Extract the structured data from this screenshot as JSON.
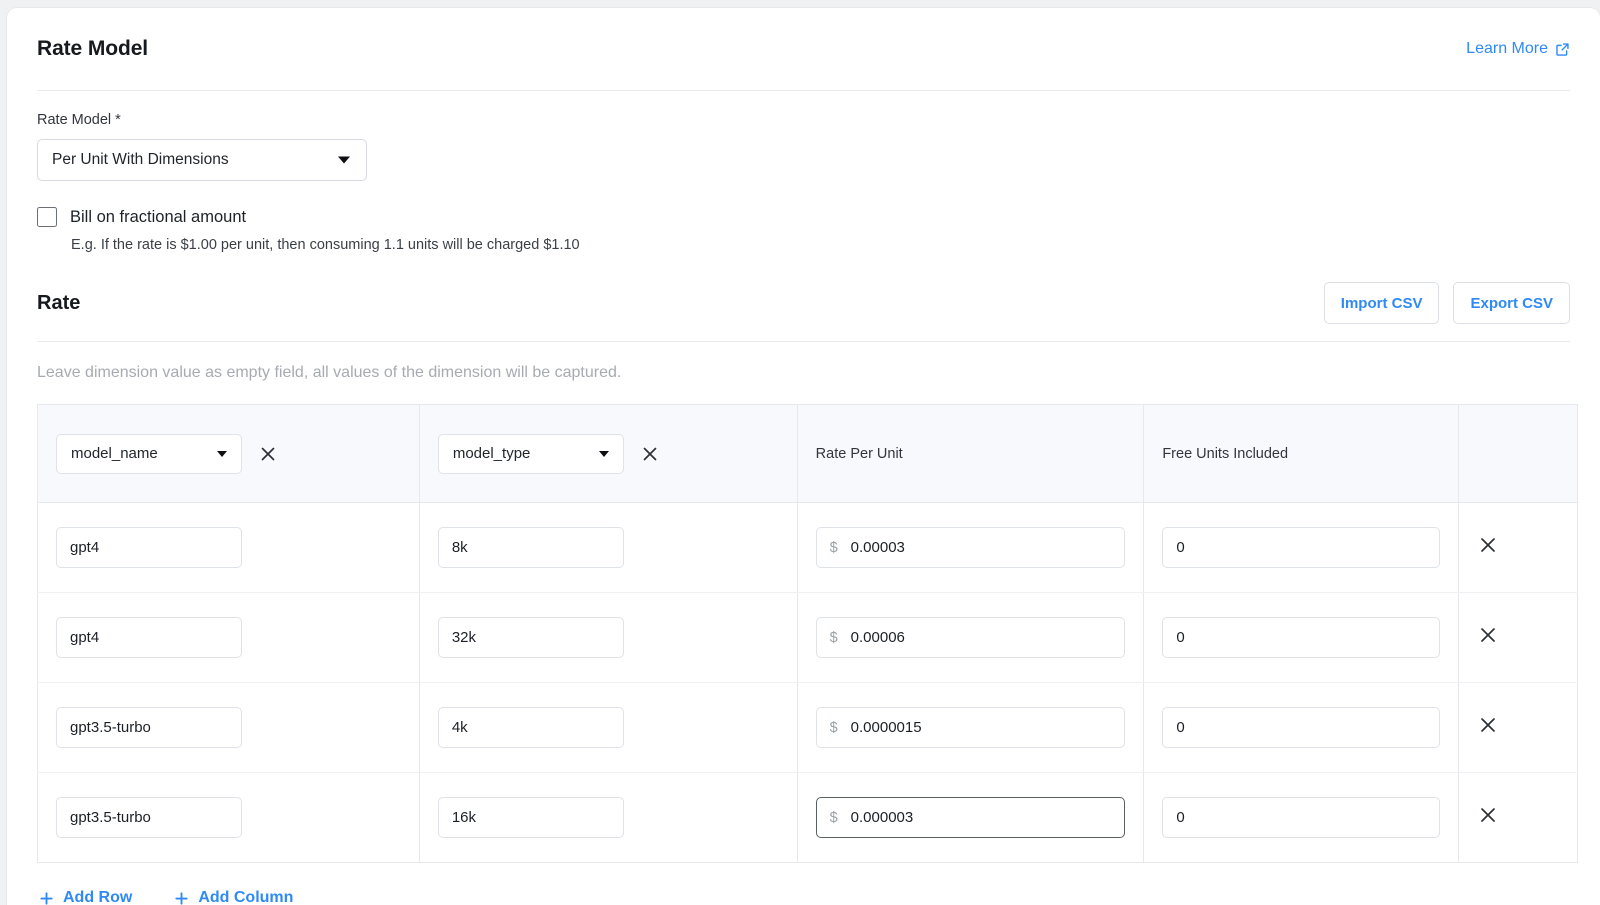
{
  "section": {
    "title": "Rate Model",
    "learn_more": "Learn More",
    "learn_more_icon": "external-link-icon"
  },
  "rate_model_field": {
    "label": "Rate Model *",
    "value": "Per Unit With Dimensions",
    "caret_icon": "chevron-down-icon"
  },
  "fractional": {
    "label": "Bill on fractional amount",
    "checked": false,
    "help": "E.g. If the rate is $1.00 per unit, then consuming 1.1 units will be charged $1.10"
  },
  "rate_section": {
    "title": "Rate",
    "import_csv": "Import CSV",
    "export_csv": "Export CSV",
    "hint": "Leave dimension value as empty field, all values of the dimension will be captured."
  },
  "table": {
    "dimension_columns": [
      {
        "value": "model_name",
        "remove_icon": "close-icon"
      },
      {
        "value": "model_type",
        "remove_icon": "close-icon"
      }
    ],
    "value_columns": [
      {
        "title": "Rate Per Unit"
      },
      {
        "title": "Free Units Included"
      }
    ],
    "currency_symbol": "$",
    "rows": [
      {
        "model_name": "gpt4",
        "model_type": "8k",
        "rate_per_unit": "0.00003",
        "free_units": "0",
        "rate_focused": false,
        "remove_icon": "close-icon"
      },
      {
        "model_name": "gpt4",
        "model_type": "32k",
        "rate_per_unit": "0.00006",
        "free_units": "0",
        "rate_focused": false,
        "remove_icon": "close-icon"
      },
      {
        "model_name": "gpt3.5-turbo",
        "model_type": "4k",
        "rate_per_unit": "0.0000015",
        "free_units": "0",
        "rate_focused": false,
        "remove_icon": "close-icon"
      },
      {
        "model_name": "gpt3.5-turbo",
        "model_type": "16k",
        "rate_per_unit": "0.000003",
        "free_units": "0",
        "rate_focused": true,
        "remove_icon": "close-icon"
      }
    ]
  },
  "footer": {
    "add_row": "Add Row",
    "add_column": "Add Column",
    "add_icon": "plus-icon"
  },
  "colors": {
    "accent": "#2f8af5",
    "header_bg": "#f7f9fc",
    "border": "#e6e8eb",
    "text": "#16191d",
    "muted": "#a7abb1"
  }
}
